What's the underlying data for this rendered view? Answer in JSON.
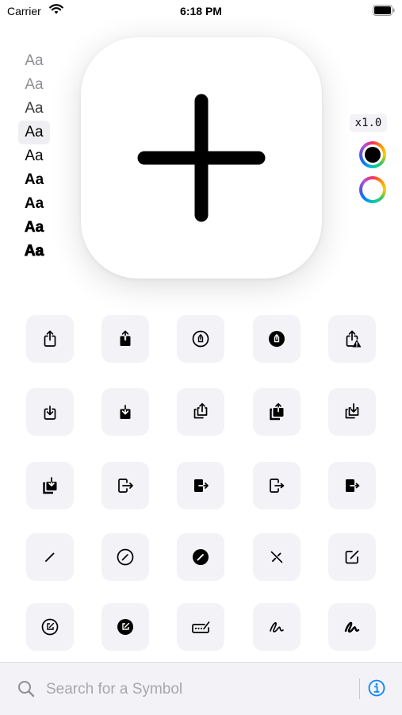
{
  "status_bar": {
    "carrier": "Carrier",
    "time": "6:18 PM"
  },
  "weights": {
    "sample": "Aa",
    "items": [
      "Ultralight",
      "Thin",
      "Light",
      "Regular",
      "Medium",
      "Semibold",
      "Bold",
      "Heavy",
      "Black"
    ],
    "selected_index": 3
  },
  "preview": {
    "symbol_icon": "plus-icon"
  },
  "scale": {
    "label": "x1.0"
  },
  "colors": {
    "primary": "#000000",
    "secondary": "#ffffff",
    "accent": "#0a84ff",
    "tile_bg": "#f2f2f7"
  },
  "symbols": [
    "square-and-arrow-up-icon",
    "square-and-arrow-up-fill-icon",
    "square-and-arrow-up-circle-icon",
    "square-and-arrow-up-circle-fill-icon",
    "square-and-arrow-up-trianglebadge-exclamationmark-icon",
    "square-and-arrow-down-icon",
    "square-and-arrow-down-fill-icon",
    "square-and-arrow-up-on-square-icon",
    "square-and-arrow-up-on-square-fill-icon",
    "square-and-arrow-down-on-square-icon",
    "square-and-arrow-down-on-square-fill-icon",
    "rectangle-portrait-and-arrow-right-icon",
    "rectangle-portrait-and-arrow-right-fill-icon",
    "rectangle-portrait-and-arrow-forward-icon",
    "rectangle-portrait-and-arrow-forward-fill-icon",
    "pencil-icon",
    "pencil-circle-icon",
    "pencil-circle-fill-icon",
    "pencil-slash-icon",
    "square-and-pencil-icon",
    "square-and-pencil-circle-icon",
    "square-and-pencil-circle-fill-icon",
    "rectangle-and-pencil-and-ellipsis-icon",
    "scribble-icon",
    "scribble-variable-icon"
  ],
  "search": {
    "placeholder": "Search for a Symbol",
    "value": ""
  }
}
